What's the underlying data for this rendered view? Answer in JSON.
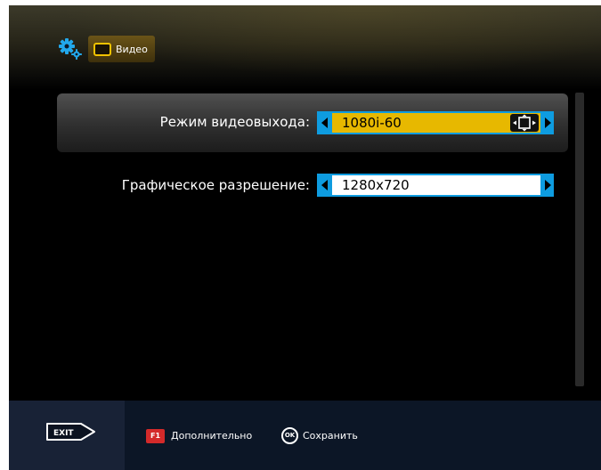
{
  "header": {
    "settings_icon": "gears-icon",
    "tab_icon": "tv-icon",
    "tab_label": "Видео"
  },
  "settings": [
    {
      "label": "Режим видеовыхода:",
      "value": "1080i-60",
      "selected": true,
      "extra_icon": "aspect-ratio-icon"
    },
    {
      "label": "Графическое разрешение:",
      "value": "1280x720",
      "selected": false
    }
  ],
  "footer": {
    "exit_key": "EXIT",
    "f1_key": "F1",
    "f1_label": "Дополнительно",
    "ok_key": "OK",
    "ok_label": "Сохранить"
  },
  "colors": {
    "accent_blue": "#0e9ce0",
    "highlight_yellow": "#e7b800",
    "f1_red": "#d42a2a",
    "footer_bg": "#0c1626"
  }
}
